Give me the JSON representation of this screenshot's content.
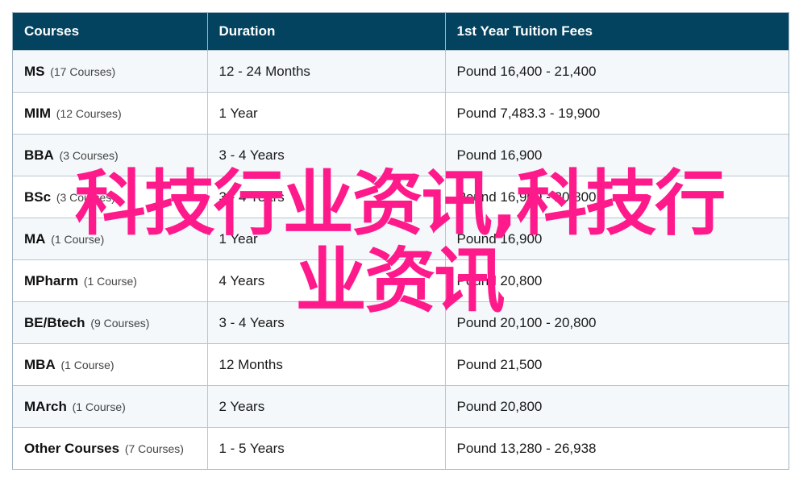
{
  "table": {
    "headers": [
      "Courses",
      "Duration",
      "1st Year Tuition Fees"
    ],
    "rows": [
      {
        "course": "MS",
        "count": "(17 Courses)",
        "duration": "12 - 24 Months",
        "fee": "Pound 16,400 - 21,400"
      },
      {
        "course": "MIM",
        "count": "(12 Courses)",
        "duration": "1 Year",
        "fee": "Pound 7,483.3 - 19,900"
      },
      {
        "course": "BBA",
        "count": "(3 Courses)",
        "duration": "3 - 4 Years",
        "fee": "Pound 16,900"
      },
      {
        "course": "BSc",
        "count": "(3 Courses)",
        "duration": "3 - 4 Years",
        "fee": "Pound 16,900 - 20,800"
      },
      {
        "course": "MA",
        "count": "(1 Course)",
        "duration": "1 Year",
        "fee": "Pound 16,900"
      },
      {
        "course": "MPharm",
        "count": "(1 Course)",
        "duration": "4 Years",
        "fee": "Pound 20,800"
      },
      {
        "course": "BE/Btech",
        "count": "(9 Courses)",
        "duration": "3 - 4 Years",
        "fee": "Pound 20,100 - 20,800"
      },
      {
        "course": "MBA",
        "count": "(1 Course)",
        "duration": "12 Months",
        "fee": "Pound 21,500"
      },
      {
        "course": "MArch",
        "count": "(1 Course)",
        "duration": "2 Years",
        "fee": "Pound 20,800"
      },
      {
        "course": "Other Courses",
        "count": "(7 Courses)",
        "duration": "1 - 5 Years",
        "fee": "Pound 13,280 - 26,938"
      }
    ]
  },
  "overlay": {
    "line1": "科技行业资讯,科技行",
    "line2": "业资讯",
    "color": "#ff1a8c"
  },
  "colors": {
    "header_bg": "#04435f",
    "stripe_bg": "#f4f8fb"
  }
}
